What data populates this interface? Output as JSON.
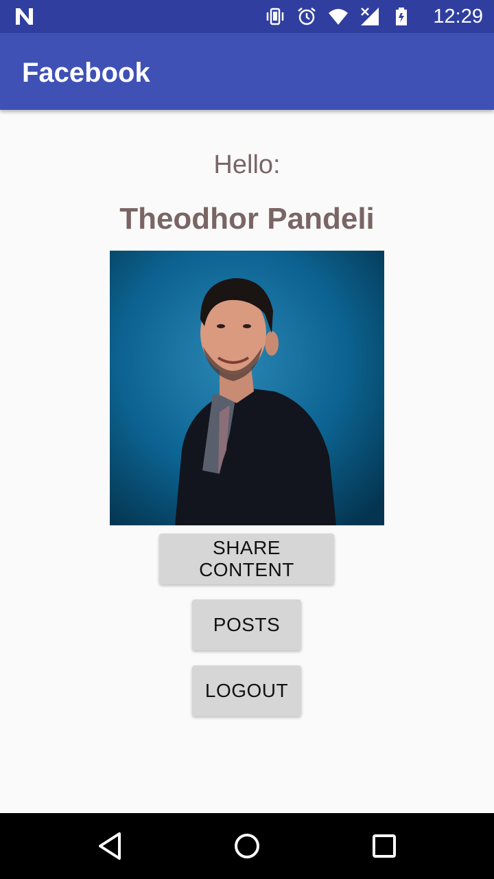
{
  "status_bar": {
    "time": "12:29",
    "left_icon": "n-notification-icon",
    "icons": [
      "vibrate-icon",
      "alarm-icon",
      "wifi-icon",
      "signal-icon",
      "battery-icon"
    ],
    "color": "#303f9f"
  },
  "app_bar": {
    "title": "Facebook",
    "color": "#3f51b5"
  },
  "main": {
    "greeting": "Hello:",
    "user_name": "Theodhor Pandeli",
    "profile_photo": "profile-photo-icon",
    "text_color": "#7a6565",
    "buttons": {
      "share_label": "SHARE CONTENT",
      "posts_label": "POSTS",
      "logout_label": "LOGOUT"
    },
    "button_color": "#d6d6d6"
  },
  "nav_bar": {
    "icons": [
      "back-icon",
      "home-icon",
      "recent-apps-icon"
    ]
  }
}
